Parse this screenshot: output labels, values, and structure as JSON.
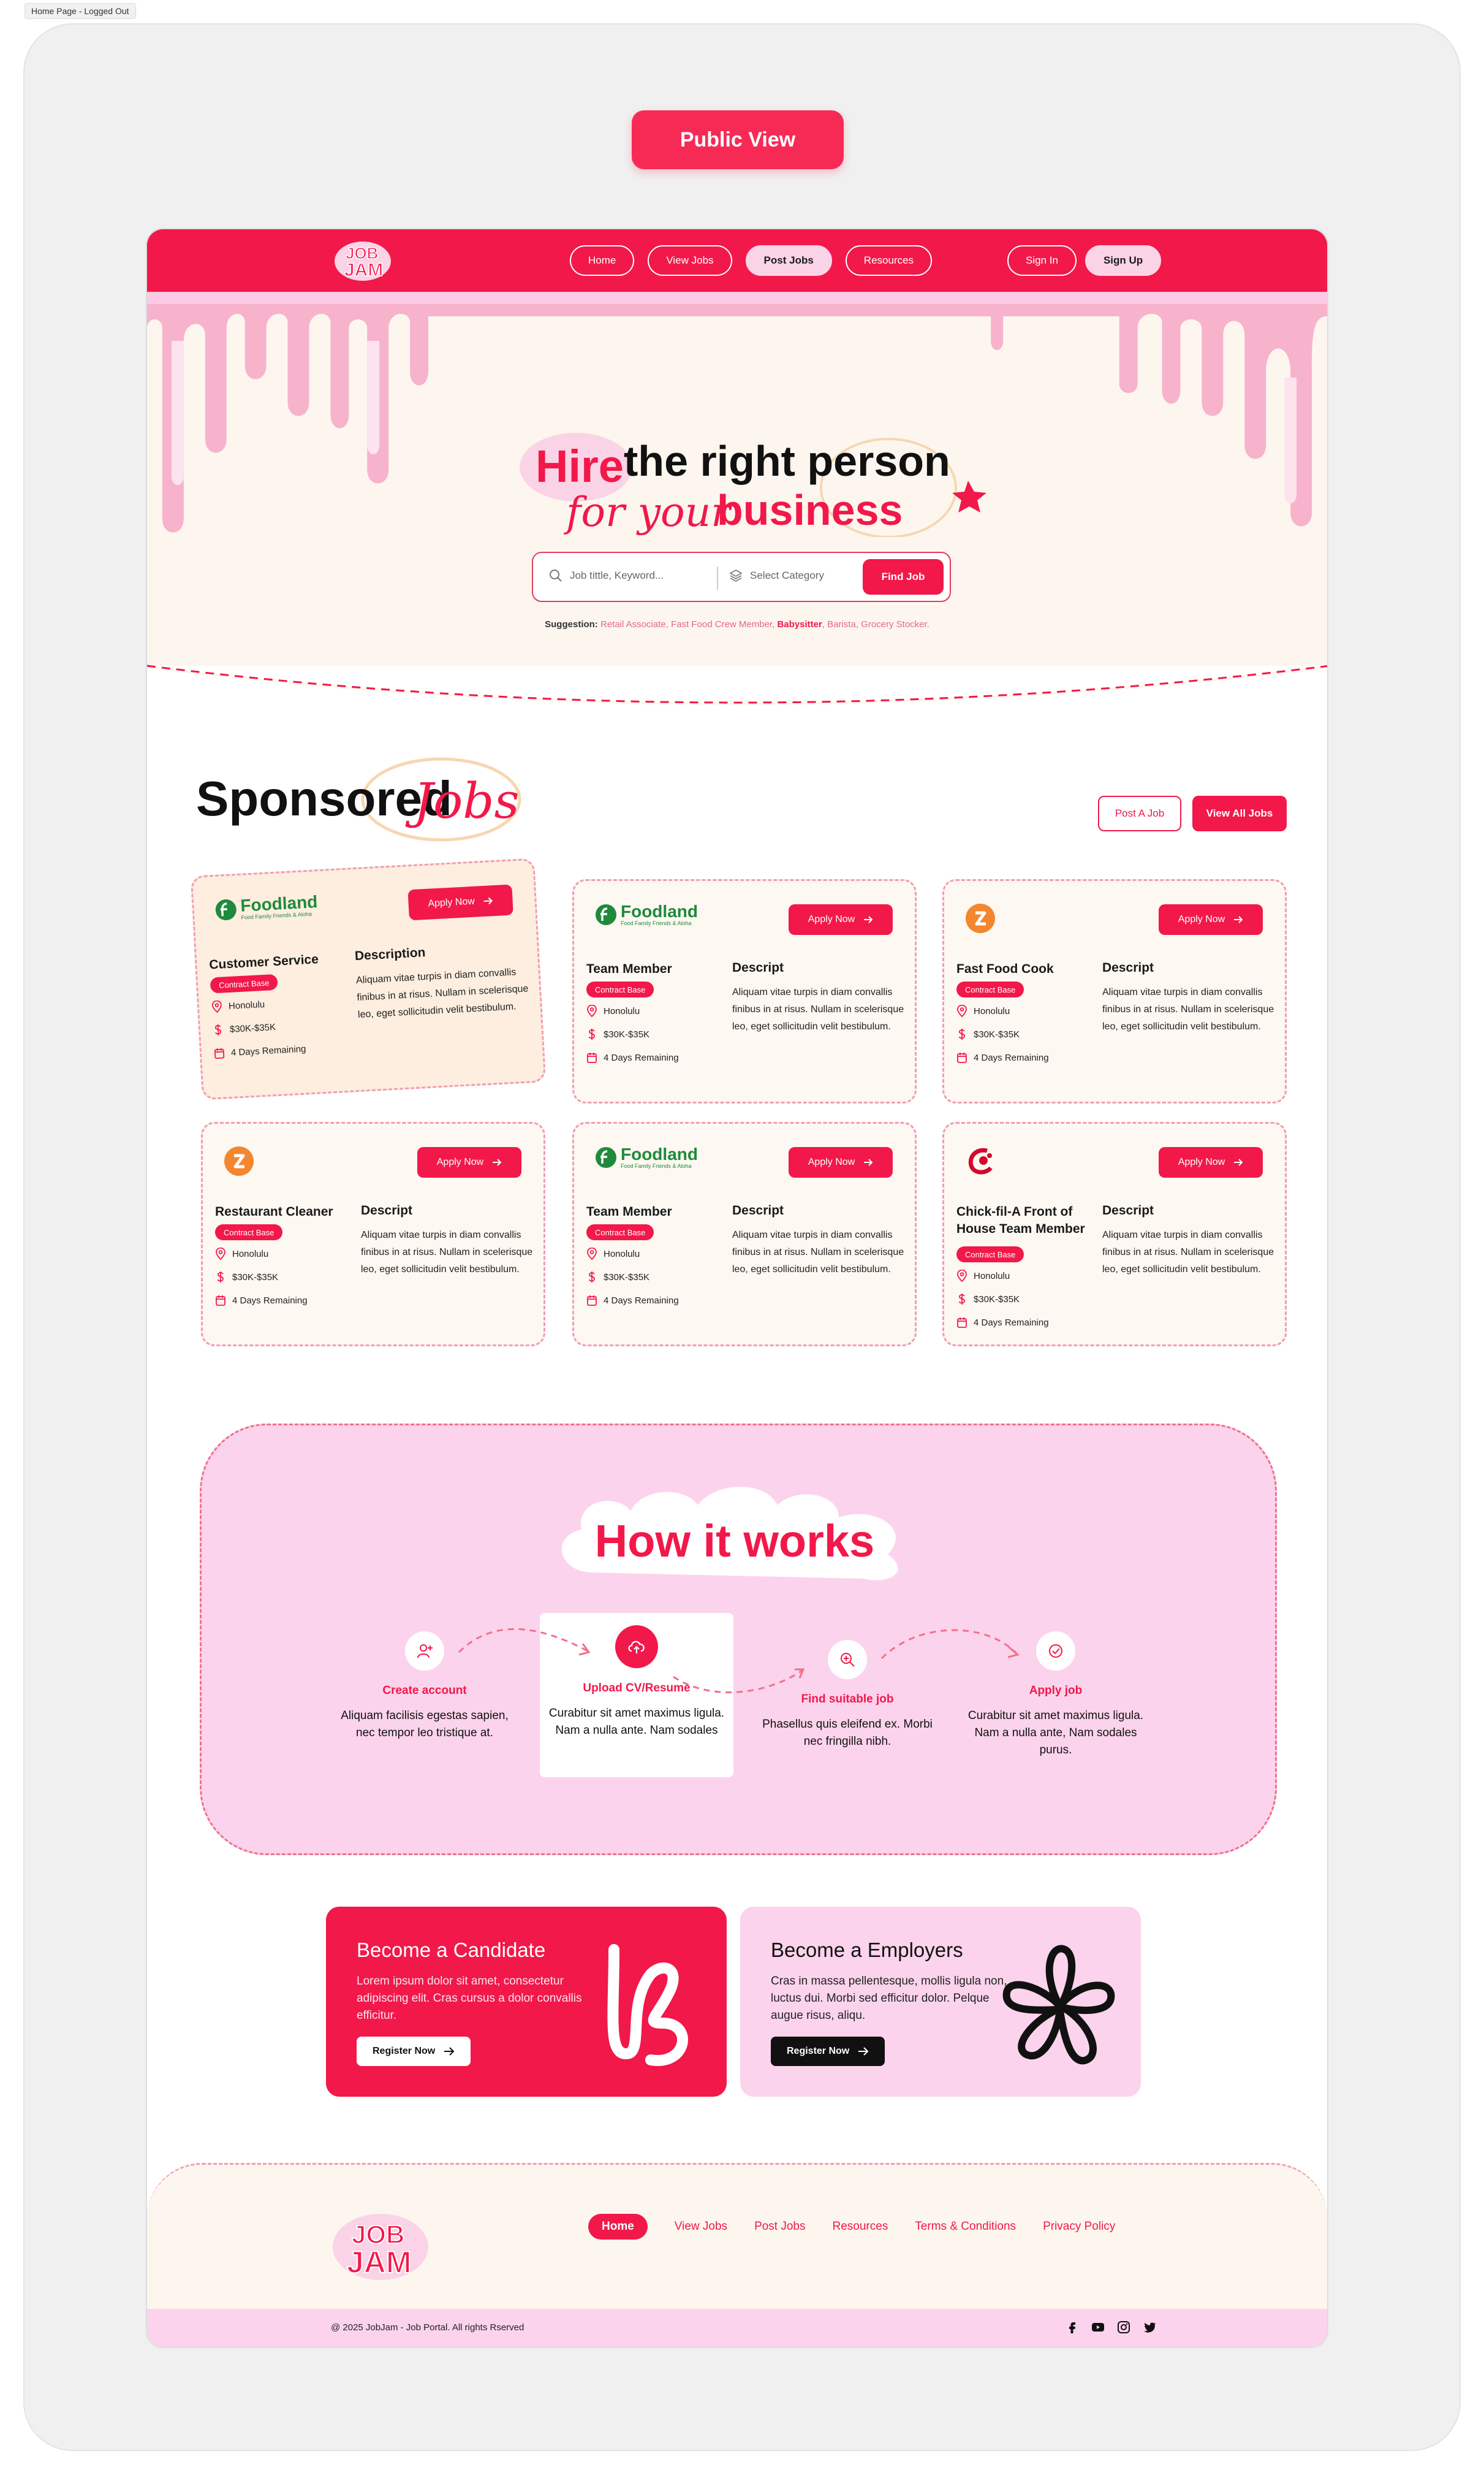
{
  "canvas_tag": "Home Page - Logged Out",
  "view_button": "Public View",
  "brand": {
    "logo_text": "JOB JAM",
    "accent": "#f2184a",
    "pink": "#fcd3ec",
    "cream": "#fdf6ef"
  },
  "nav": {
    "links": [
      {
        "label": "Home",
        "active": false
      },
      {
        "label": "View Jobs",
        "active": false
      },
      {
        "label": "Post Jobs",
        "active": true
      },
      {
        "label": "Resources",
        "active": false
      }
    ],
    "signin": "Sign In",
    "signup": "Sign Up"
  },
  "hero": {
    "title_hire": "Hire",
    "title_rest": "the right person",
    "title_for": "for your",
    "title_business": "business",
    "search_placeholder": "Job tittle, Keyword...",
    "category_placeholder": "Select Category",
    "find_button": "Find Job",
    "suggestion_label": "Suggestion:",
    "suggestions_before": "Retail Associate, Fast Food Crew Member,",
    "suggestion_highlight": "Babysitter",
    "suggestions_after": ", Barista, Grocery Stocker."
  },
  "sponsored": {
    "title_a": "Sponsored",
    "title_b": "Jobs",
    "post_button": "Post A Job",
    "view_all_button": "View All Jobs",
    "apply_label": "Apply Now",
    "jobs": [
      {
        "company": "foodland",
        "title": "Customer Service",
        "type": "Contract Base",
        "location": "Honolulu",
        "salary": "$30K-$35K",
        "remaining": "4 Days Remaining",
        "desc_title": "Description",
        "desc": "Aliquam vitae turpis in diam convallis finibus in at risus. Nullam in scelerisque leo, eget sollicitudin velit bestibulum."
      },
      {
        "company": "foodland",
        "title": "Team Member",
        "type": "Contract Base",
        "location": "Honolulu",
        "salary": "$30K-$35K",
        "remaining": "4 Days Remaining",
        "desc_title": "Descript",
        "desc": "Aliquam vitae turpis in diam convallis finibus in at risus. Nullam in scelerisque leo, eget sollicitudin velit bestibulum."
      },
      {
        "company": "zippys",
        "title": "Fast Food Cook",
        "type": "Contract Base",
        "location": "Honolulu",
        "salary": "$30K-$35K",
        "remaining": "4 Days Remaining",
        "desc_title": "Descript",
        "desc": "Aliquam vitae turpis in diam convallis finibus in at risus. Nullam in scelerisque leo, eget sollicitudin velit bestibulum."
      },
      {
        "company": "zippys",
        "title": "Restaurant Cleaner",
        "type": "Contract Base",
        "location": "Honolulu",
        "salary": "$30K-$35K",
        "remaining": "4 Days Remaining",
        "desc_title": "Descript",
        "desc": "Aliquam vitae turpis in diam convallis finibus in at risus. Nullam in scelerisque leo, eget sollicitudin velit bestibulum."
      },
      {
        "company": "foodland",
        "title": "Team Member",
        "type": "Contract Base",
        "location": "Honolulu",
        "salary": "$30K-$35K",
        "remaining": "4 Days Remaining",
        "desc_title": "Descript",
        "desc": "Aliquam vitae turpis in diam convallis finibus in at risus. Nullam in scelerisque leo, eget sollicitudin velit bestibulum."
      },
      {
        "company": "chickfila",
        "title": "Chick-fil-A Front of House Team Member",
        "type": "Contract Base",
        "location": "Honolulu",
        "salary": "$30K-$35K",
        "remaining": "4 Days Remaining",
        "desc_title": "Descript",
        "desc": "Aliquam vitae turpis in diam convallis finibus in at risus. Nullam in scelerisque leo, eget sollicitudin velit bestibulum."
      }
    ],
    "foodland_name": "Foodland",
    "foodland_tag": "Food Family Friends & Aloha"
  },
  "how": {
    "title": "How it works",
    "steps": [
      {
        "title": "Create account",
        "desc": "Aliquam facilisis egestas sapien, nec tempor leo tristique at."
      },
      {
        "title": "Upload CV/Resume",
        "desc": "Curabitur sit amet maximus ligula. Nam a nulla ante. Nam sodales"
      },
      {
        "title": "Find suitable job",
        "desc": "Phasellus quis eleifend ex. Morbi nec fringilla nibh."
      },
      {
        "title": "Apply job",
        "desc": "Curabitur sit amet maximus ligula. Nam a nulla ante, Nam sodales purus."
      }
    ]
  },
  "cta": {
    "candidate_title": "Become a Candidate",
    "candidate_desc": "Lorem ipsum dolor sit amet, consectetur adipiscing elit. Cras cursus a dolor convallis efficitur.",
    "employer_title": "Become a Employers",
    "employer_desc": "Cras in massa pellentesque, mollis ligula non, luctus dui. Morbi sed efficitur dolor. Pelque augue risus, aliqu.",
    "register": "Register Now"
  },
  "footer": {
    "links": [
      "Home",
      "View Jobs",
      "Post Jobs",
      "Resources",
      "Terms & Conditions",
      "Privacy Policy"
    ],
    "copyright": "@ 2025 JobJam - Job Portal. All rights Rserved",
    "social_icons": [
      "facebook-icon",
      "youtube-icon",
      "instagram-icon",
      "twitter-icon"
    ]
  }
}
